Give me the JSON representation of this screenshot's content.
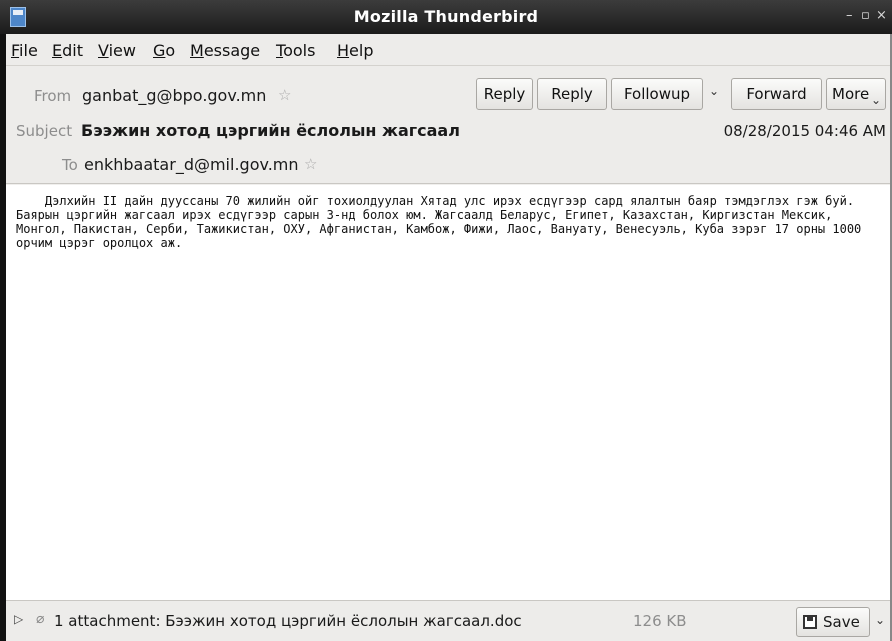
{
  "window": {
    "title": "Mozilla Thunderbird",
    "controls": {
      "minimize": "–",
      "maximize": "▫",
      "close": "×"
    }
  },
  "menu": {
    "file": "File",
    "edit": "Edit",
    "view": "View",
    "go": "Go",
    "message": "Message",
    "tools": "Tools",
    "help": "Help"
  },
  "header": {
    "from_label": "From",
    "from_value": "ganbat_g@bpo.gov.mn",
    "subject_label": "Subject",
    "subject_value": "Бээжин хотод цэргийн ёслолын жагсаал",
    "to_label": "To",
    "to_value": "enkhbaatar_d@mil.gov.mn",
    "date": "08/28/2015 04:46 AM",
    "star_glyph": "☆"
  },
  "toolbar": {
    "reply1": "Reply",
    "reply2": "Reply",
    "followup": "Followup",
    "forward": "Forward",
    "more": "More",
    "chevron": "⌄"
  },
  "body": {
    "text": "    Дэлхийн II дайн дууссаны 70 жилийн ойг тохиолдуулан Хятад улс ирэх есдүгээр сард ялалтын баяр тэмдэглэх гэж буй. Баярын цэргийн жагсаал ирэх есдүгээр сарын 3-нд болох юм. Жагсаалд Беларус, Египет, Казахстан, Киргизстан Мексик, Монгол, Пакистан, Серби, Тажикистан, ОХУ, Афганистан, Камбож, Фижи, Лаос, Вануату, Венесуэль, Куба зэрэг 17 орны 1000 орчим цэрэг оролцох аж."
  },
  "attachment": {
    "expand_glyph": "▷",
    "clip_glyph": "⌀",
    "text": "1 attachment: Бээжин хотод цэргийн ёслолын жагсаал.doc",
    "size": "126 KB",
    "save_label": "Save",
    "chevron": "⌄"
  },
  "colors": {
    "titlebar": "#1b1b1b",
    "chrome": "#edecea",
    "label_gray": "#8d8d8d",
    "app_icon": "#4d86c9"
  }
}
